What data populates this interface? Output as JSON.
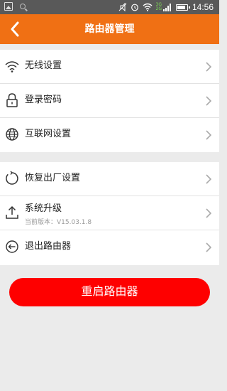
{
  "status_bar": {
    "net_top": "3G",
    "net_bottom": "2G",
    "time": "14:56",
    "icons": [
      "image-icon",
      "search-icon",
      "mute-icon",
      "alarm-icon",
      "wifi-icon",
      "signal-icon",
      "battery-icon"
    ]
  },
  "header": {
    "title": "路由器管理",
    "back_icon": "chevron-left-icon",
    "background": "#f07014"
  },
  "groups": [
    {
      "items": [
        {
          "label": "无线设置",
          "icon": "wifi-icon"
        },
        {
          "label": "登录密码",
          "icon": "lock-icon"
        },
        {
          "label": "互联网设置",
          "icon": "globe-icon"
        }
      ]
    },
    {
      "items": [
        {
          "label": "恢复出厂设置",
          "icon": "restore-icon"
        },
        {
          "label": "系统升级",
          "icon": "upload-icon",
          "sub": "当前版本：V15.03.1.8"
        },
        {
          "label": "退出路由器",
          "icon": "exit-icon"
        }
      ]
    }
  ],
  "reboot_button": {
    "label": "重启路由器",
    "color": "#fe0000"
  }
}
